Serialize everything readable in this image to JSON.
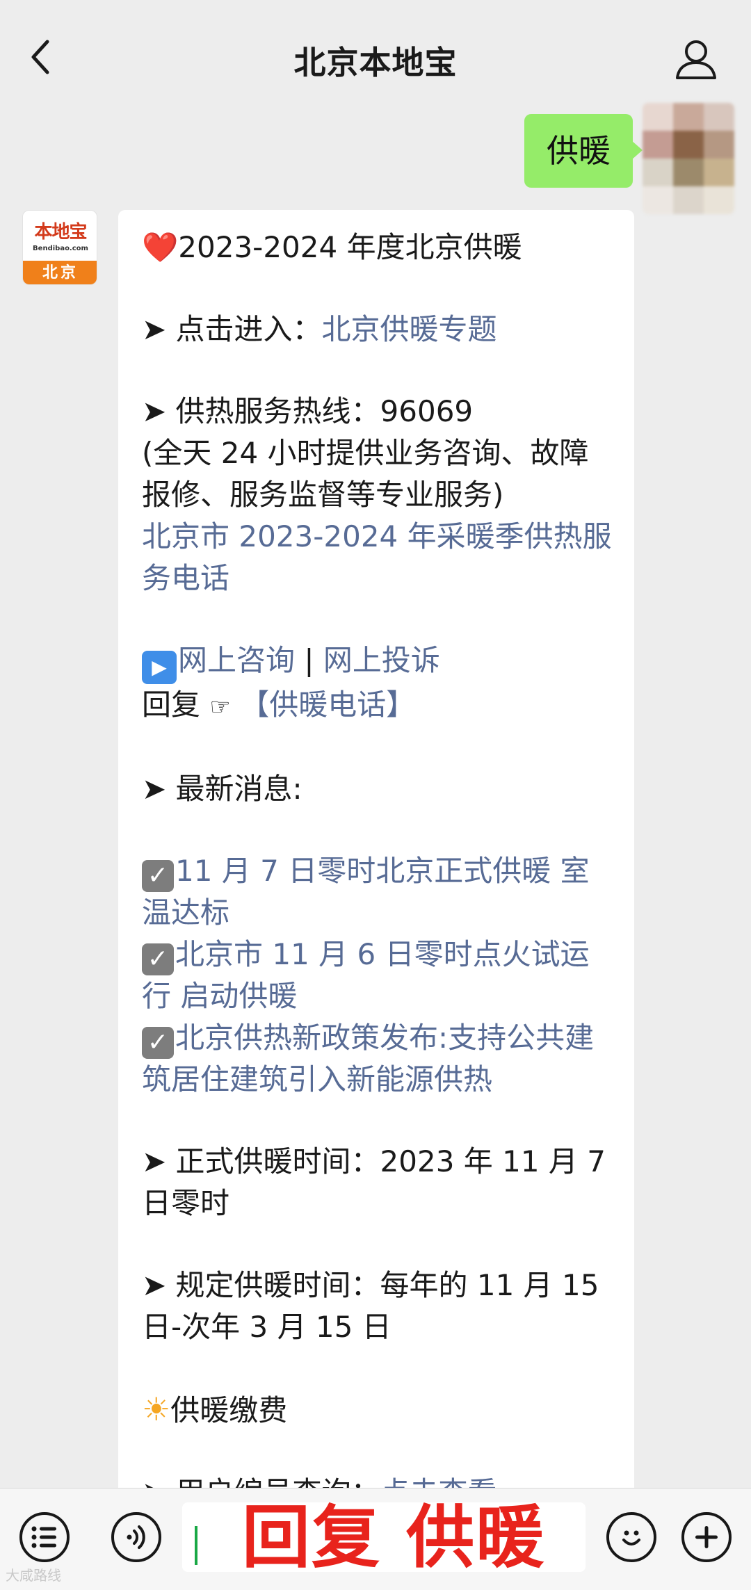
{
  "header": {
    "title": "北京本地宝",
    "back_icon": "chevron-left-icon",
    "profile_icon": "person-icon"
  },
  "outgoing": {
    "text": "供暖"
  },
  "account_avatar": {
    "brand": "本地宝",
    "domain": "Bendibao.com",
    "city": "北京",
    "brand_color": "#d33a1b",
    "band_color": "#f0801a"
  },
  "reply": {
    "title_emoji": "❤️",
    "title": "2023-2024 年度北京供暖",
    "entry_prefix": "➤ 点击进入：",
    "entry_link": "北京供暖专题",
    "hotline_label": "➤ 供热服务热线：96069",
    "hotline_note": "(全天 24 小时提供业务咨询、故障报修、服务监督等专业服务)",
    "hotline_link": "北京市 2023-2024 年采暖季供热服务电话",
    "online_consult": "网上咨询",
    "separator": " | ",
    "online_complaint": "网上投诉",
    "reply_prefix": "回复",
    "reply_hand": "☞",
    "reply_link": "【供暖电话】",
    "news_label": "➤ 最新消息:",
    "news": [
      "11 月 7 日零时北京正式供暖 室温达标",
      "北京市 11 月 6 日零时点火试运行 启动供暖",
      "北京供热新政策发布:支持公共建筑居住建筑引入新能源供热"
    ],
    "official_time": "➤ 正式供暖时间：2023 年 11 月 7 日零时",
    "regulated_time": "➤ 规定供暖时间：每年的 11 月 15 日-次年 3 月 15 日",
    "payment_label": "供暖缴费",
    "user_query_prefix": "➤ 用户编号查询：",
    "user_query_link": "点击查看",
    "link_color": "#576b95"
  },
  "inputbar": {
    "list_icon": "list-icon",
    "voice_icon": "voice-icon",
    "input_value": "回复 供暖",
    "emoji_icon": "smiley-icon",
    "plus_icon": "plus-icon"
  },
  "watermark": "大咸路线"
}
